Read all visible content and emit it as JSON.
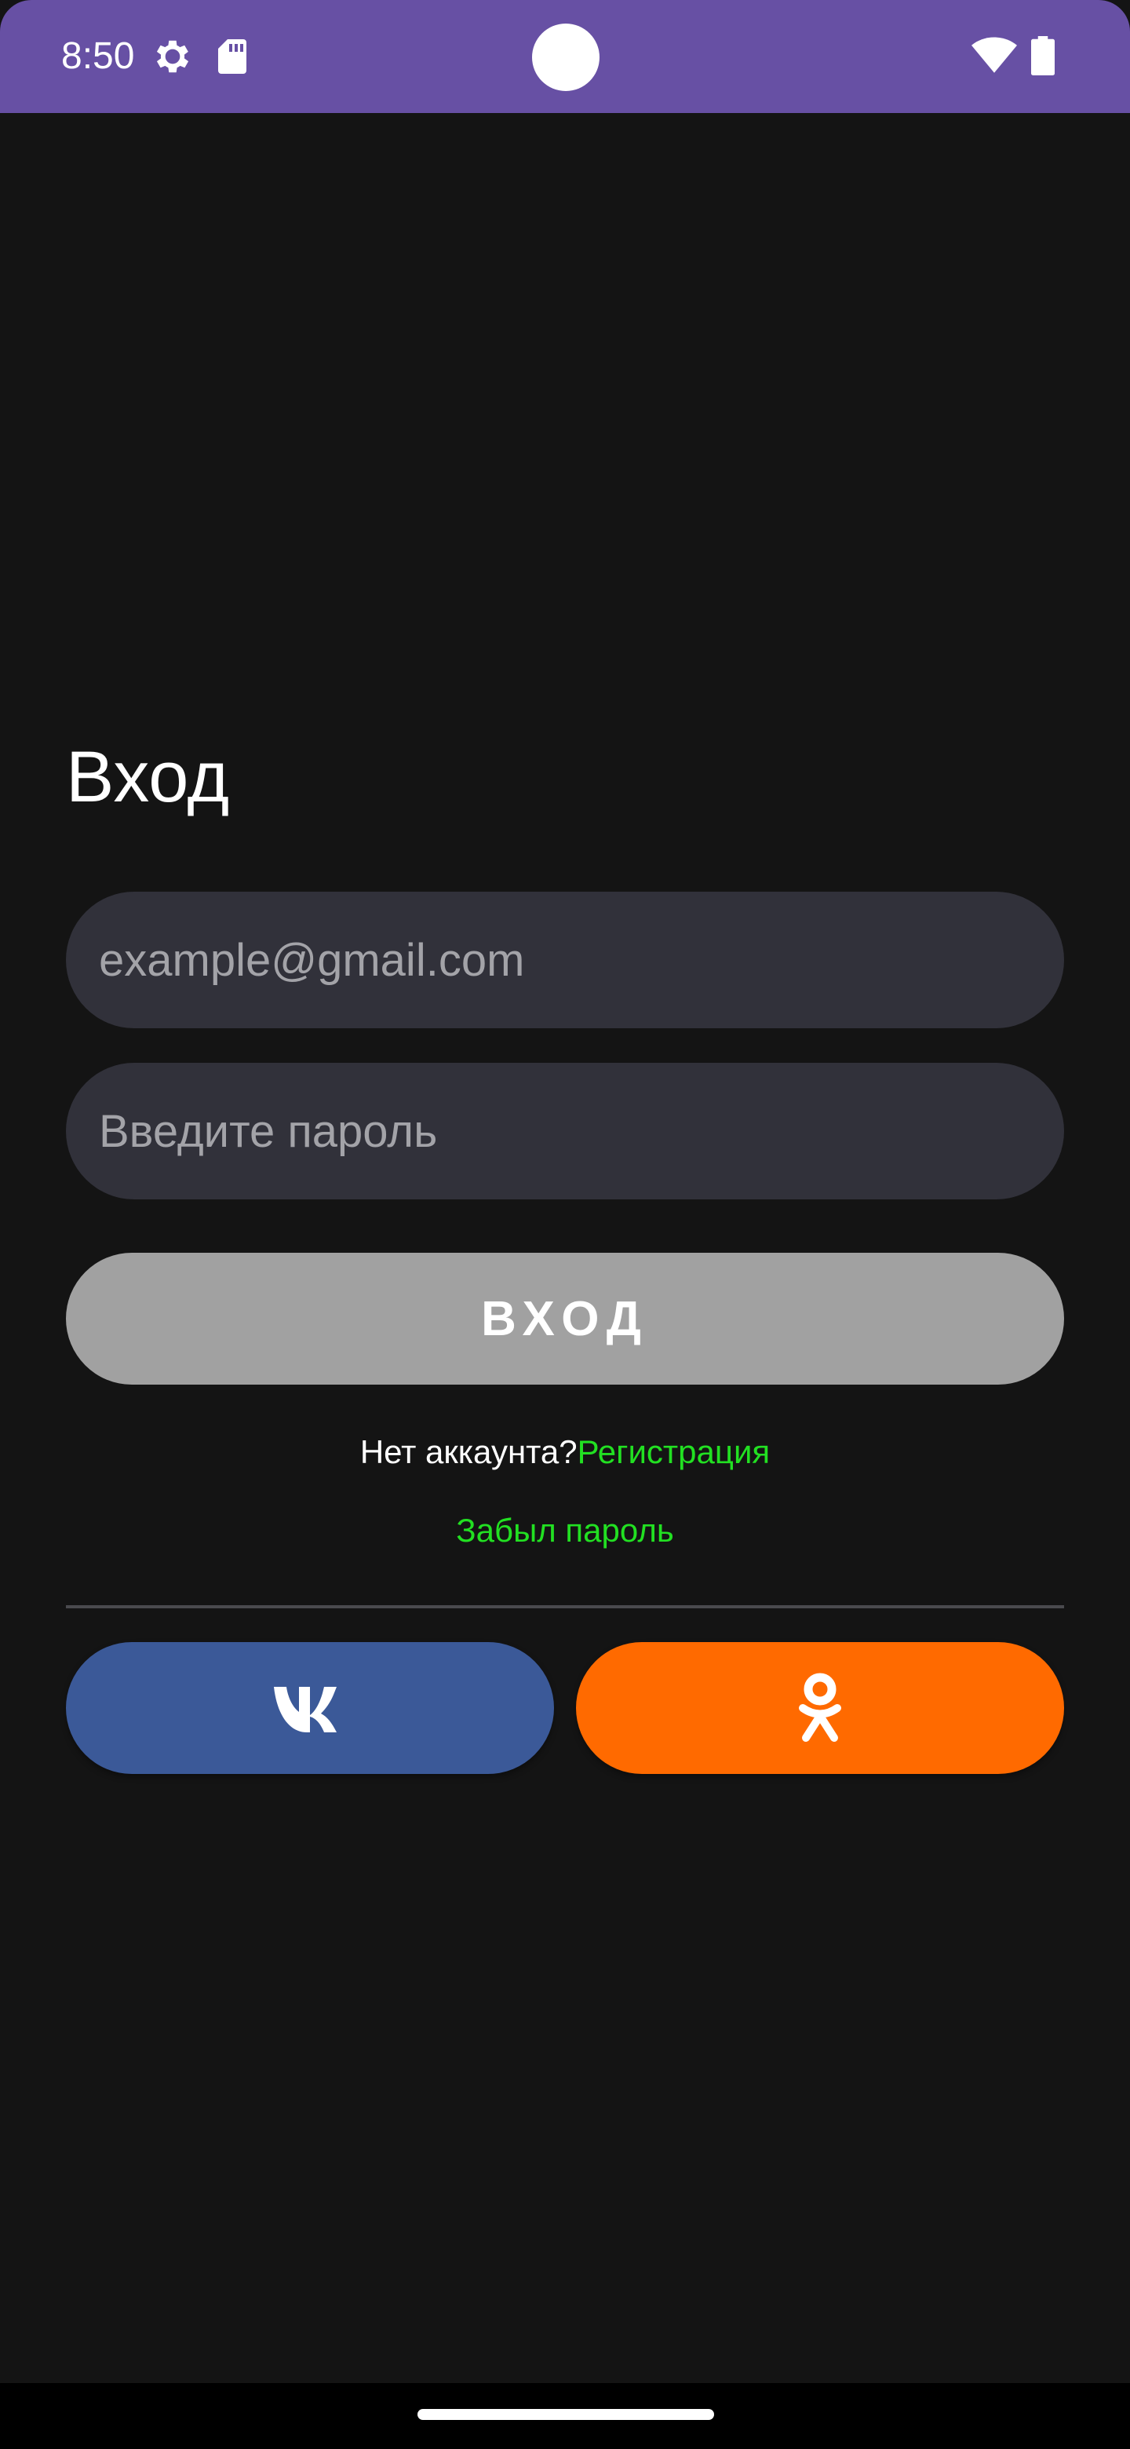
{
  "status_bar": {
    "time": "8:50",
    "icons": [
      "settings-gear-icon",
      "sd-card-icon",
      "camera-cutout",
      "wifi-icon",
      "battery-icon"
    ],
    "background_color": "#6750a4"
  },
  "login": {
    "title": "Вход",
    "email": {
      "value": "",
      "placeholder": "example@gmail.com"
    },
    "password": {
      "value": "",
      "placeholder": "Введите пароль"
    },
    "submit_label": "ВХОД",
    "no_account_text": "Нет аккаунта?",
    "register_link": "Регистрация",
    "forgot_password_link": "Забыл пароль"
  },
  "social": {
    "vk": {
      "icon": "vk-logo-icon",
      "color": "#3b5998"
    },
    "ok": {
      "icon": "odnoklassniki-logo-icon",
      "color": "#ff6a00"
    }
  },
  "colors": {
    "background": "#141414",
    "field_background": "#31313a",
    "button_disabled": "#a1a1a1",
    "link": "#22e022"
  }
}
